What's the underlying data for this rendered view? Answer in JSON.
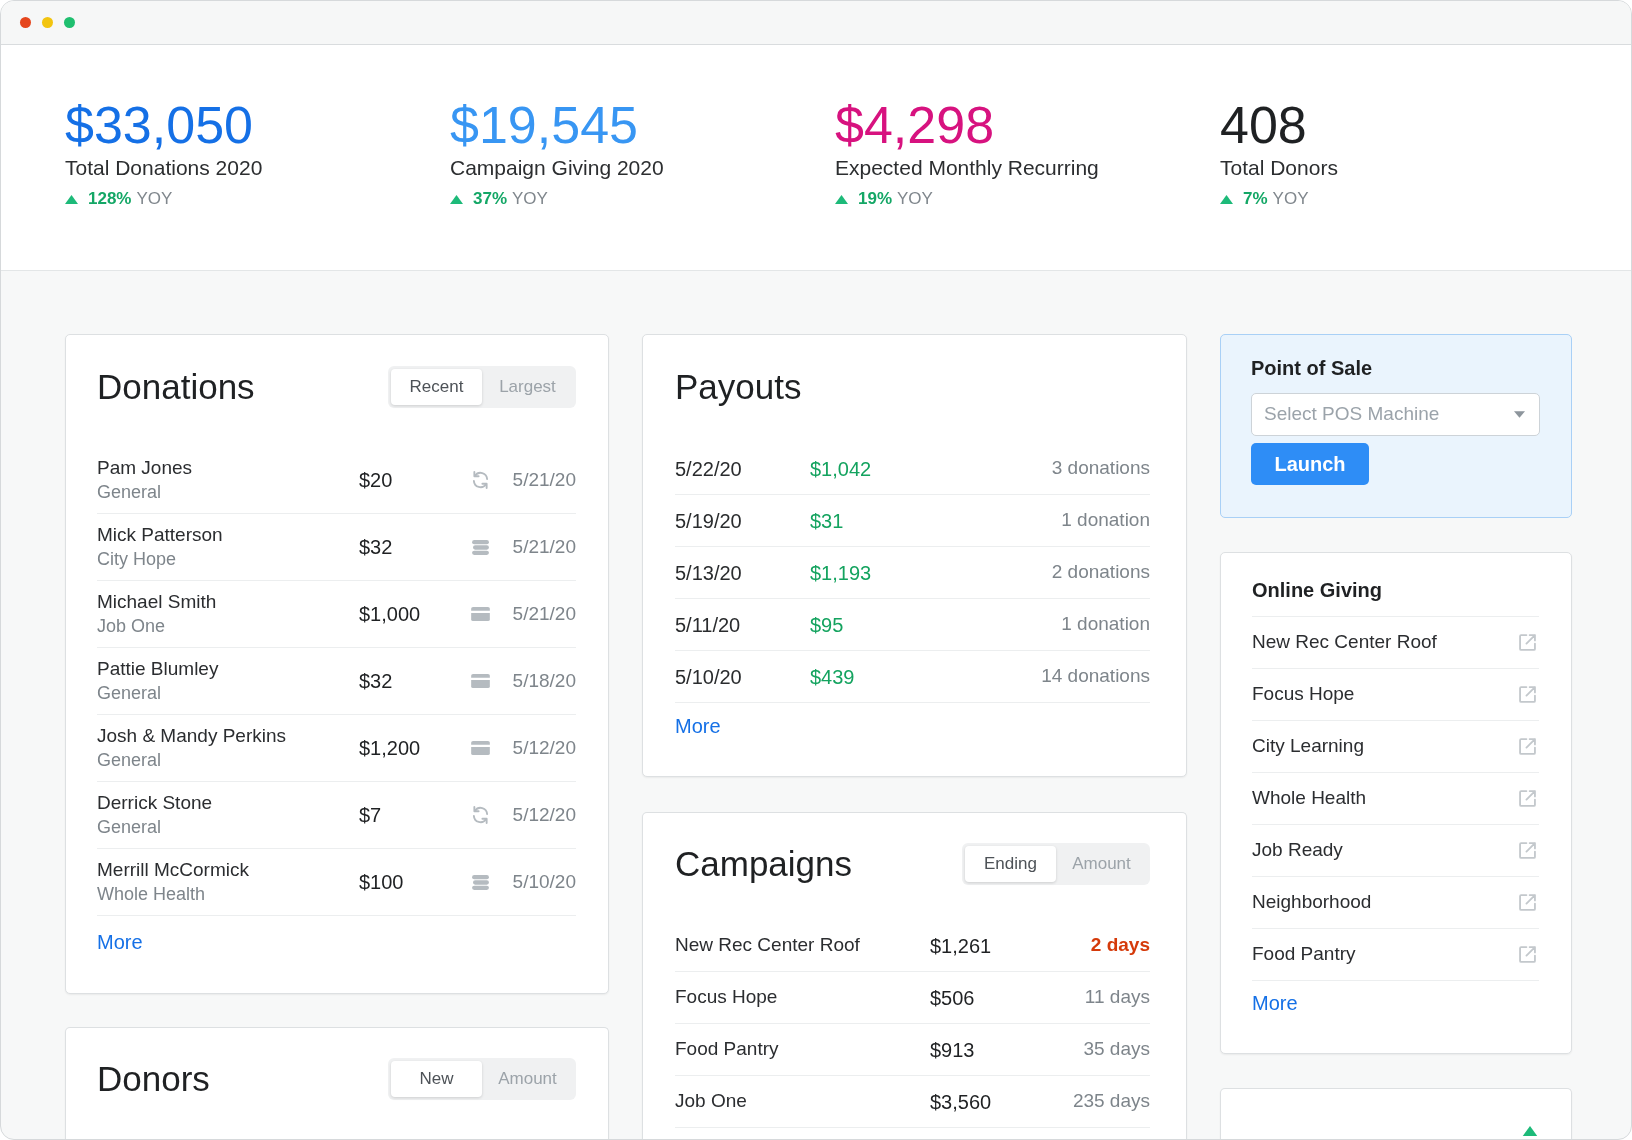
{
  "stats": [
    {
      "value": "$33,050",
      "label": "Total Donations 2020",
      "change": "128%",
      "period": "YOY",
      "rising": true,
      "color": "#1570e6"
    },
    {
      "value": "$19,545",
      "label": "Campaign Giving 2020",
      "change": "37%",
      "period": "YOY",
      "rising": true,
      "color": "#3896f3"
    },
    {
      "value": "$4,298",
      "label": "Expected Monthly Recurring",
      "change": "19%",
      "period": "YOY",
      "rising": true,
      "color": "#d7127f"
    },
    {
      "value": "408",
      "label": "Total Donors",
      "change": "7%",
      "period": "YOY",
      "rising": true,
      "color": "#1f2123"
    }
  ],
  "donations": {
    "title": "Donations",
    "sort_tabs": [
      {
        "label": "Recent",
        "selected": true
      },
      {
        "label": "Largest",
        "selected": false
      }
    ],
    "rows": [
      {
        "name": "Pam Jones",
        "fund": "General",
        "amount": "$20",
        "kind": "recurring",
        "date": "5/21/20"
      },
      {
        "name": "Mick Patterson",
        "fund": "City Hope",
        "amount": "$32",
        "kind": "cash",
        "date": "5/21/20"
      },
      {
        "name": "Michael Smith",
        "fund": "Job One",
        "amount": "$1,000",
        "kind": "card",
        "date": "5/21/20"
      },
      {
        "name": "Pattie Blumley",
        "fund": "General",
        "amount": "$32",
        "kind": "card",
        "date": "5/18/20"
      },
      {
        "name": "Josh & Mandy Perkins",
        "fund": "General",
        "amount": "$1,200",
        "kind": "card",
        "date": "5/12/20"
      },
      {
        "name": "Derrick Stone",
        "fund": "General",
        "amount": "$7",
        "kind": "recurring",
        "date": "5/12/20"
      },
      {
        "name": "Merrill McCormick",
        "fund": "Whole Health",
        "amount": "$100",
        "kind": "cash",
        "date": "5/10/20"
      }
    ],
    "more": "More"
  },
  "donors": {
    "title": "Donors",
    "sort_tabs": [
      {
        "label": "New",
        "selected": true
      },
      {
        "label": "Amount",
        "selected": false
      }
    ]
  },
  "payouts": {
    "title": "Payouts",
    "rows": [
      {
        "date": "5/22/20",
        "amount": "$1,042",
        "count": "3 donations"
      },
      {
        "date": "5/19/20",
        "amount": "$31",
        "count": "1 donation"
      },
      {
        "date": "5/13/20",
        "amount": "$1,193",
        "count": "2 donations"
      },
      {
        "date": "5/11/20",
        "amount": "$95",
        "count": "1 donation"
      },
      {
        "date": "5/10/20",
        "amount": "$439",
        "count": "14 donations"
      }
    ],
    "more": "More"
  },
  "campaigns": {
    "title": "Campaigns",
    "sort_tabs": [
      {
        "label": "Ending",
        "selected": true
      },
      {
        "label": "Amount",
        "selected": false
      }
    ],
    "rows": [
      {
        "name": "New Rec Center Roof",
        "amount": "$1,261",
        "time_left": "2 days",
        "urgent": true
      },
      {
        "name": "Focus Hope",
        "amount": "$506",
        "time_left": "11 days",
        "urgent": false
      },
      {
        "name": "Food Pantry",
        "amount": "$913",
        "time_left": "35 days",
        "urgent": false
      },
      {
        "name": "Job One",
        "amount": "$3,560",
        "time_left": "235 days",
        "urgent": false
      }
    ]
  },
  "point_of_sale": {
    "title": "Point of Sale",
    "select": {
      "placeholder": "Select POS Machine"
    },
    "button": "Launch"
  },
  "online_giving": {
    "title": "Online Giving",
    "items": [
      "New Rec Center Roof",
      "Focus Hope",
      "City Learning",
      "Whole Health",
      "Job Ready",
      "Neighborhood",
      "Food Pantry"
    ],
    "more": "More"
  },
  "summary_card": {
    "rising": true
  }
}
